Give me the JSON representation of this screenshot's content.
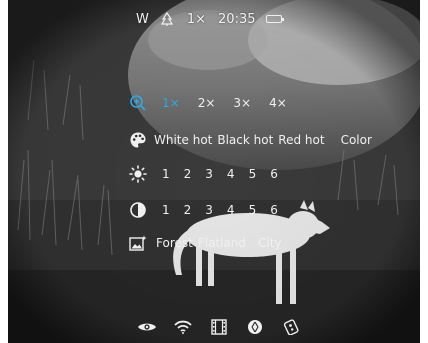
{
  "status_bar": {
    "mode": "W",
    "zoom": "1×",
    "time": "20:35",
    "battery_level": 1.0,
    "battery_color": "#22d15a"
  },
  "menu": {
    "accent_color": "#2ea8e8",
    "zoom_row": {
      "icon": "zoom-in-icon",
      "options": [
        "1×",
        "2×",
        "3×",
        "4×"
      ],
      "selected": "1×"
    },
    "palette_row": {
      "icon": "palette-icon",
      "options": [
        "White hot",
        "Black hot",
        "Red hot",
        "Color"
      ]
    },
    "brightness_row": {
      "icon": "brightness-icon",
      "options": [
        "1",
        "2",
        "3",
        "4",
        "5",
        "6"
      ]
    },
    "contrast_row": {
      "icon": "contrast-icon",
      "options": [
        "1",
        "2",
        "3",
        "4",
        "5",
        "6"
      ]
    },
    "scene_row": {
      "icon": "scene-mode-icon",
      "options": [
        "Forest",
        "Flatland",
        "City"
      ]
    }
  },
  "bottom_bar": {
    "icons": [
      "eye-icon",
      "wifi-icon",
      "film-icon",
      "shutter-icon",
      "remote-icon"
    ]
  }
}
